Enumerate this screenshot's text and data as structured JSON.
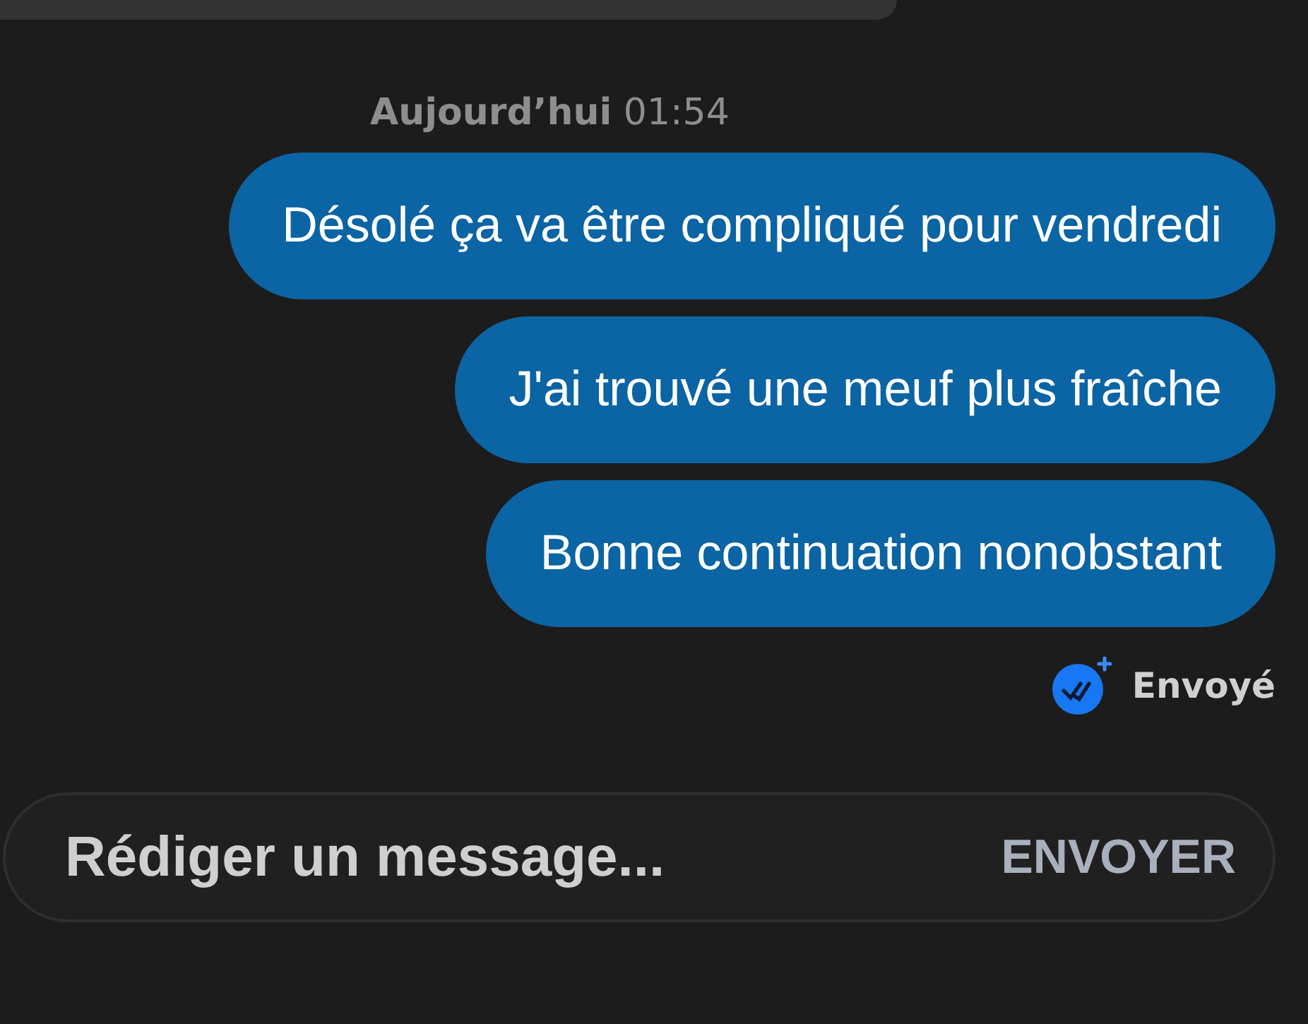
{
  "timestamp": "**Aujourd’hui** 01:54",
  "messages": [
    {
      "text": "Désolé ça va être compliqué pour vendredi"
    },
    {
      "text": "J'ai trouvé une meuf plus fraîche"
    },
    {
      "text": "Bonne continuation nonobstant"
    }
  ],
  "status": {
    "label": "Envoyé"
  },
  "composer": {
    "placeholder": "Rédiger un message...",
    "send": "ENVOYER"
  }
}
